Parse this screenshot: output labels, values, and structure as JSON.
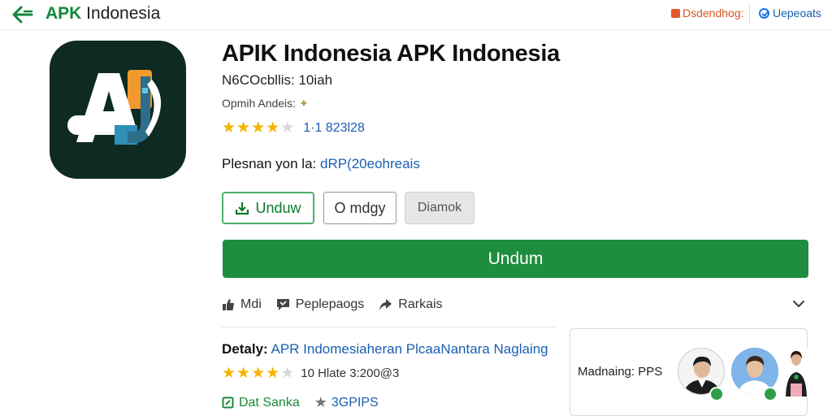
{
  "header": {
    "brand_prefix": "APK",
    "brand_suffix": " Indonesia",
    "right_link_1": "Dsdendhog:",
    "right_link_2": "Uepeoats"
  },
  "app": {
    "title": "APIK Indonesia  APK Indonesia",
    "subtitle": "N6COcbllis: 10iah",
    "developer_line": "Opmih Andeis:",
    "rating_stars": 4,
    "rating_count": "1·1 823l28",
    "permission_label": "Plesnan yon la:",
    "permission_link": "dRP(20eohreais"
  },
  "buttons": {
    "unduh_outline": "Unduw",
    "mdgy": "O mdgy",
    "gray": "Diamok",
    "main": "Undum"
  },
  "actions": {
    "item1": "Mdi",
    "item2": "Peplepaogs",
    "item3": "Rarkais"
  },
  "details": {
    "label": "Detaly:",
    "text": "APR Indomesiaheran PlcaaNantara Naglaing",
    "rating_stars": 4,
    "meta": "10 Hlate  3:200@3",
    "green_label": "Dat Sanka",
    "gray_label": "3GPIPS"
  },
  "card": {
    "label": "Madnaing: PPS"
  },
  "colors": {
    "primary_green": "#1e8e3e",
    "link_blue": "#1a5fb4",
    "star": "#f5b400",
    "icon_bg": "#0f2a23"
  }
}
